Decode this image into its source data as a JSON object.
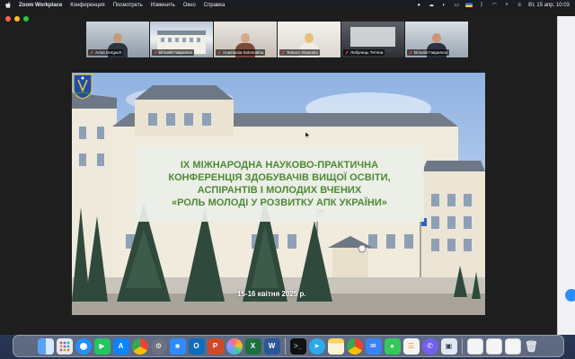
{
  "menubar": {
    "app_name": "Zoom Workplace",
    "menus": [
      "Конференция",
      "Посмотреть",
      "Изменить",
      "Окно",
      "Справка"
    ],
    "clock": "Вт, 15 апр.  10:03"
  },
  "participants": [
    {
      "name": "Anna Dergach"
    },
    {
      "name": "Віталій Гаврилюк"
    },
    {
      "name": "Anastasiia Solomakha"
    },
    {
      "name": "Tetiana Vlasenko"
    },
    {
      "name": "Лобунець Тетяна"
    },
    {
      "name": "Віталій Гаврилюк"
    }
  ],
  "slide": {
    "title_lines": [
      "IX МІЖНАРОДНА НАУКОВО-ПРАКТИЧНА",
      "КОНФЕРЕНЦІЯ ЗДОБУВАЧІВ ВИЩОЇ ОСВІТИ,",
      "АСПІРАНТІВ І МОЛОДИХ ВЧЕНИХ",
      "«РОЛЬ МОЛОДІ У РОЗВИТКУ АПК УКРАЇНИ»"
    ],
    "date": "15-16 квітня 2025 р."
  },
  "colors": {
    "title_green": "#4d8a34",
    "zoom_blue": "#2d8cff",
    "window_bg": "#1e1e1e"
  },
  "dock": {
    "icons": [
      {
        "name": "finder-icon",
        "color": "#3b82f6"
      },
      {
        "name": "launchpad-icon",
        "color": "#e5e7eb"
      },
      {
        "name": "safari-icon",
        "color": "#1e90ff"
      },
      {
        "name": "facetime-icon",
        "color": "#22c55e"
      },
      {
        "name": "app-store-icon",
        "color": "#0a84ff"
      },
      {
        "name": "chrome-icon",
        "color": "#f1f1f1"
      },
      {
        "name": "settings-icon",
        "color": "#6b7280"
      },
      {
        "name": "zoom-icon",
        "color": "#2d8cff"
      },
      {
        "name": "outlook-icon",
        "color": "#0f6cbd"
      },
      {
        "name": "powerpoint-icon",
        "color": "#d24726"
      },
      {
        "name": "photos-icon",
        "color": "#fbbf24"
      },
      {
        "name": "excel-icon",
        "color": "#1d6f42"
      },
      {
        "name": "word-icon",
        "color": "#2b579a"
      },
      {
        "name": "terminal-icon",
        "color": "#111111"
      },
      {
        "name": "telegram-icon",
        "color": "#2aabee"
      },
      {
        "name": "notes-icon",
        "color": "#f8e08e"
      },
      {
        "name": "chrome-icon-2",
        "color": "#eaeaea"
      },
      {
        "name": "mail-icon",
        "color": "#3b82f6"
      },
      {
        "name": "messages-icon",
        "color": "#34c759"
      },
      {
        "name": "reminders-icon",
        "color": "#f4f4f4"
      },
      {
        "name": "viber-icon",
        "color": "#7360f2"
      },
      {
        "name": "preview-icon",
        "color": "#e2e8f0"
      },
      {
        "name": "doc-thumb-icon-1",
        "color": "#f5f5f5"
      },
      {
        "name": "doc-thumb-icon-2",
        "color": "#f5f5f5"
      },
      {
        "name": "doc-thumb-icon-3",
        "color": "#f5f5f5"
      },
      {
        "name": "trash-icon",
        "color": "#cbd5e1"
      }
    ]
  }
}
